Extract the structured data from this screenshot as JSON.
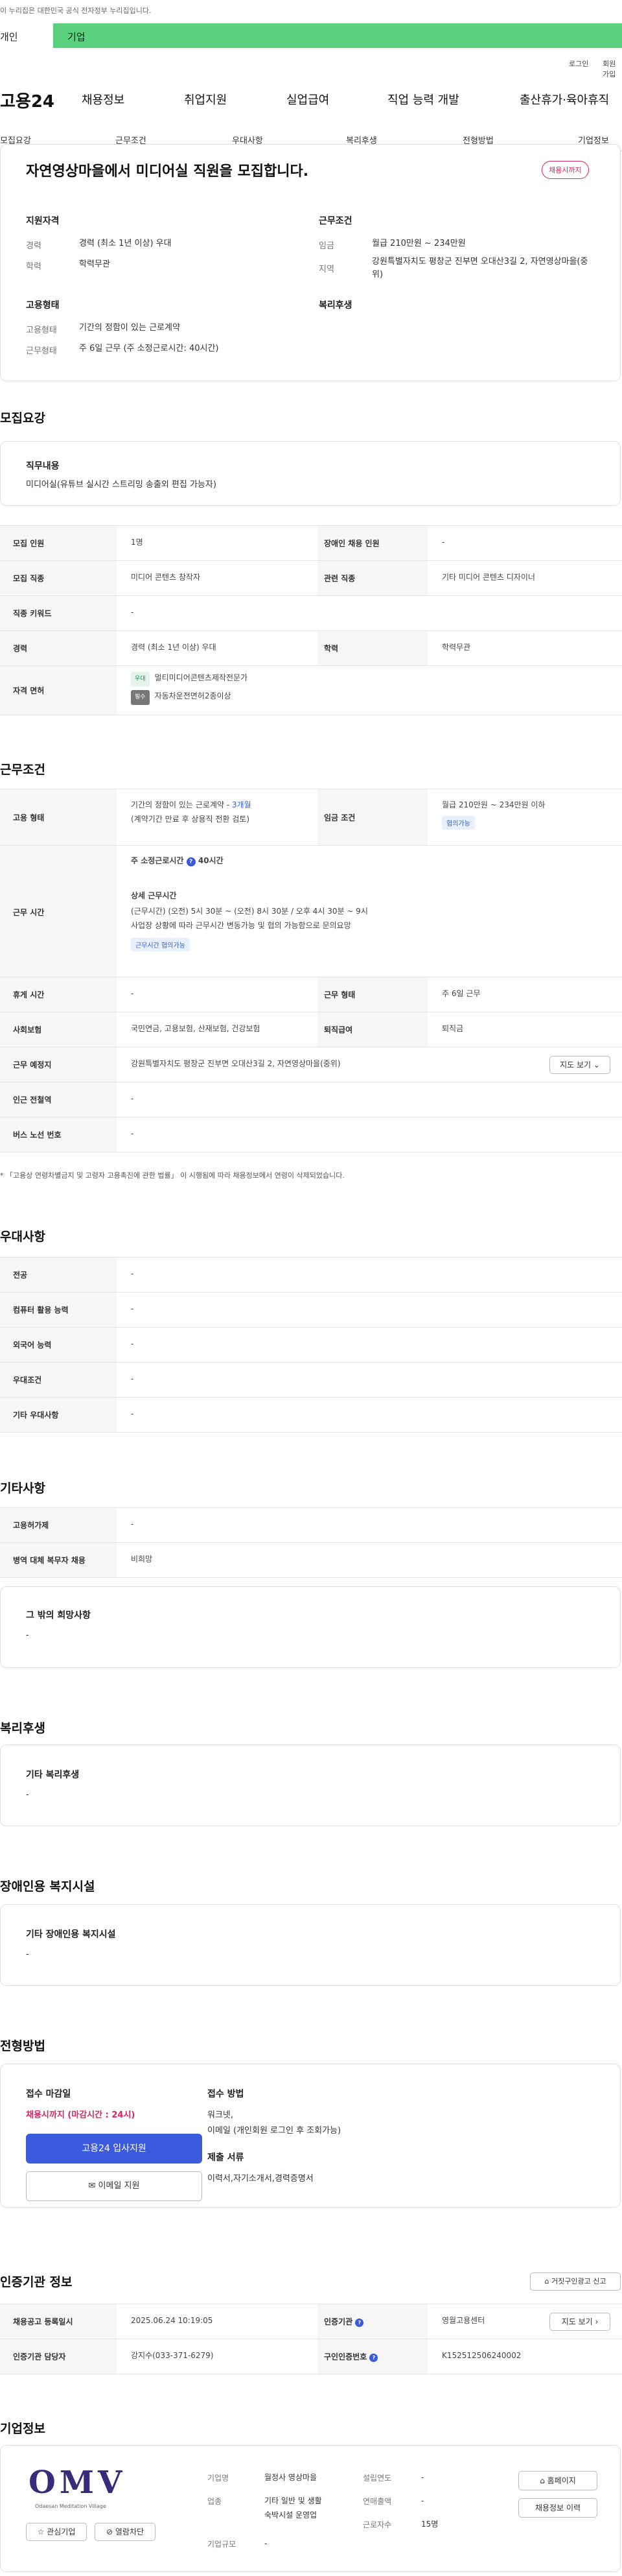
{
  "top_note": "이 누리집은 대한민국 공식 전자정부 누리집입니다.",
  "audience_tabs": [
    "개인",
    "기업"
  ],
  "util_links": [
    "로그인",
    "회원가입"
  ],
  "logo": "고용24",
  "gnb": [
    "채용정보",
    "취업지원",
    "실업급여",
    "직업 능력 개발",
    "출산휴가·육아휴직"
  ],
  "sub_nav": [
    "모집요강",
    "근무조건",
    "우대사항",
    "복리후생",
    "전형방법",
    "기업정보"
  ],
  "header_card": {
    "title": "자연영상마을에서 미디어실 직원을 모집합니다.",
    "badge": "채용시까지",
    "qual_title": "지원자격",
    "cond_title": "근무조건",
    "form_title": "고용형태",
    "welfare_title": "복리후생",
    "qual": [
      [
        "경력",
        "경력 (최소 1년 이상) 우대"
      ],
      [
        "학력",
        "학력무관"
      ]
    ],
    "cond": [
      [
        "임금",
        "월급 210만원 ~ 234만원"
      ],
      [
        "지역",
        "강원특별자치도 평창군 진부면 오대산3길 2, 자연영상마을(중위)"
      ]
    ],
    "form": [
      [
        "고용형태",
        "기간의 정함이 있는 근로계약"
      ],
      [
        "근무형태",
        "주 6일 근무 (주 소정근로시간: 40시간)"
      ]
    ]
  },
  "recruit": {
    "section": "모집요강",
    "duty_title": "직무내용",
    "duty": "미디어실(유튜브 실시간 스트리밍 송출외 편집 가능자)",
    "rows": [
      {
        "k1": "모집 인원",
        "v1": "1명",
        "k2": "장애인 채용 인원",
        "v2": "-"
      },
      {
        "k1": "모집 직종",
        "v1": "미디어 콘텐츠 창작자",
        "k2": "관련 직종",
        "v2": "기타 미디어 콘텐츠 디자이너"
      },
      {
        "k1": "직종 키워드",
        "v1": "-"
      },
      {
        "k1": "경력",
        "v1": "경력 (최소 1년 이상) 우대",
        "k2": "학력",
        "v2": "학력무관"
      },
      {
        "k1": "자격 면허"
      }
    ],
    "licenses": [
      {
        "tag": "우대",
        "name": "멀티미디어콘텐츠제작전문가"
      },
      {
        "tag": "필수",
        "name": "자동차운전면허2종이상"
      }
    ]
  },
  "work": {
    "section": "근무조건",
    "emp_k": "고용 형태",
    "emp_v1": "기간의 정함이 있는 근로계약 - ",
    "emp_v1b": "3개월",
    "emp_v2": "(계약기간 만료 후 상용직 전환 검토)",
    "wage_k": "임금 조건",
    "wage_v": "월급 210만원 ~ 234만원 이하",
    "wage_tag": "협의가능",
    "time_k": "근무 시간",
    "time_title": "주 소정근로시간",
    "time_hours": "40시간",
    "time_detail_title": "상세 근무시간",
    "time_d1": "(근무시간) (오전) 5시 30분 ~ (오전) 8시 30분 / 오후 4시 30분 ~ 9시",
    "time_d2": "사업장 상황에 따라 근무시간 변동가능 및 협의 가능함으로 문의요망",
    "time_tag": "근무시간 협의가능",
    "rows": [
      {
        "k1": "휴게 시간",
        "v1": "-",
        "k2": "근무 형태",
        "v2": "주 6일 근무"
      },
      {
        "k1": "사회보험",
        "v1": "국민연금, 고용보험, 산재보험, 건강보험",
        "k2": "퇴직급여",
        "v2": "퇴직금"
      },
      {
        "k1": "근무 예정지",
        "v1": "강원특별자치도 평창군 진부면 오대산3길 2, 자연영상마을(중위)"
      },
      {
        "k1": "인근 전철역",
        "v1": "-"
      },
      {
        "k1": "버스 노선 번호",
        "v1": "-"
      }
    ],
    "map_btn": "지도 보기",
    "footnote": "* 「고용상 연령차별금지 및 고령자 고용촉진에 관한 법률」 이 시행됨에 따라 채용정보에서 연령이 삭제되었습니다."
  },
  "prefer": {
    "section": "우대사항",
    "rows": [
      [
        "전공",
        "-"
      ],
      [
        "컴퓨터 활용 능력",
        "-"
      ],
      [
        "외국어 능력",
        "-"
      ],
      [
        "우대조건",
        "-"
      ],
      [
        "기타 우대사항",
        "-"
      ]
    ]
  },
  "etc": {
    "section": "기타사항",
    "rows": [
      [
        "고용허가제",
        "-"
      ],
      [
        "병역 대체 복무자 채용",
        "비희망"
      ]
    ],
    "box_title": "그 밖의 희망사항",
    "box_val": "-"
  },
  "welfare": {
    "section": "복리후생",
    "box_title": "기타 복리후생",
    "box_val": "-"
  },
  "disabled": {
    "section": "장애인용 복지시설",
    "box_title": "기타 장애인용 복지시설",
    "box_val": "-"
  },
  "process": {
    "section": "전형방법",
    "deadline_k": "접수 마감일",
    "deadline_v": "채용시까지 (마감시간 : 24시)",
    "apply_btn": "고용24 입사지원",
    "email_btn": "이메일 지원",
    "method_k": "접수 방법",
    "method_v1": "워크넷,",
    "method_v2": "이메일 (개인회원 로그인 후 조회가능)",
    "docs_k": "제출 서류",
    "docs_v": "이력서,자기소개서,경력증명서"
  },
  "cert": {
    "section": "인증기관 정보",
    "report_btn": "거짓구인광고 신고",
    "rows": [
      {
        "k1": "채용공고 등록일시",
        "v1": "2025.06.24 10:19:05",
        "k2": "인증기관",
        "v2": "영월고용센터"
      },
      {
        "k1": "인증기관 담당자",
        "v1": "강지수(033-371-6279)",
        "k2": "구인인증번호",
        "v2": "K152512506240002"
      }
    ],
    "map_btn": "지도 보기"
  },
  "company": {
    "section": "기업정보",
    "logo_text": "OMV",
    "logo_sub": "Odaesan Meditation Village",
    "fav_btn": "관심기업",
    "block_btn": "열람차단",
    "name_k": "기업명",
    "name_v": "월정사 영상마을",
    "industry_k": "업종",
    "industry_v1": "기타 일반 및 생활",
    "industry_v2": "숙박시설 운영업",
    "size_k": "기업규모",
    "size_v": "-",
    "founded_k": "설립연도",
    "founded_v": "-",
    "sales_k": "연매출액",
    "sales_v": "-",
    "emp_k": "근로자수",
    "emp_v": "15명",
    "home_btn": "홈페이지",
    "history_btn": "채용정보 이력"
  },
  "colors": {
    "green": "#59d17f",
    "accent_red": "#e0245e",
    "primary_blue": "#3c5bdc"
  }
}
